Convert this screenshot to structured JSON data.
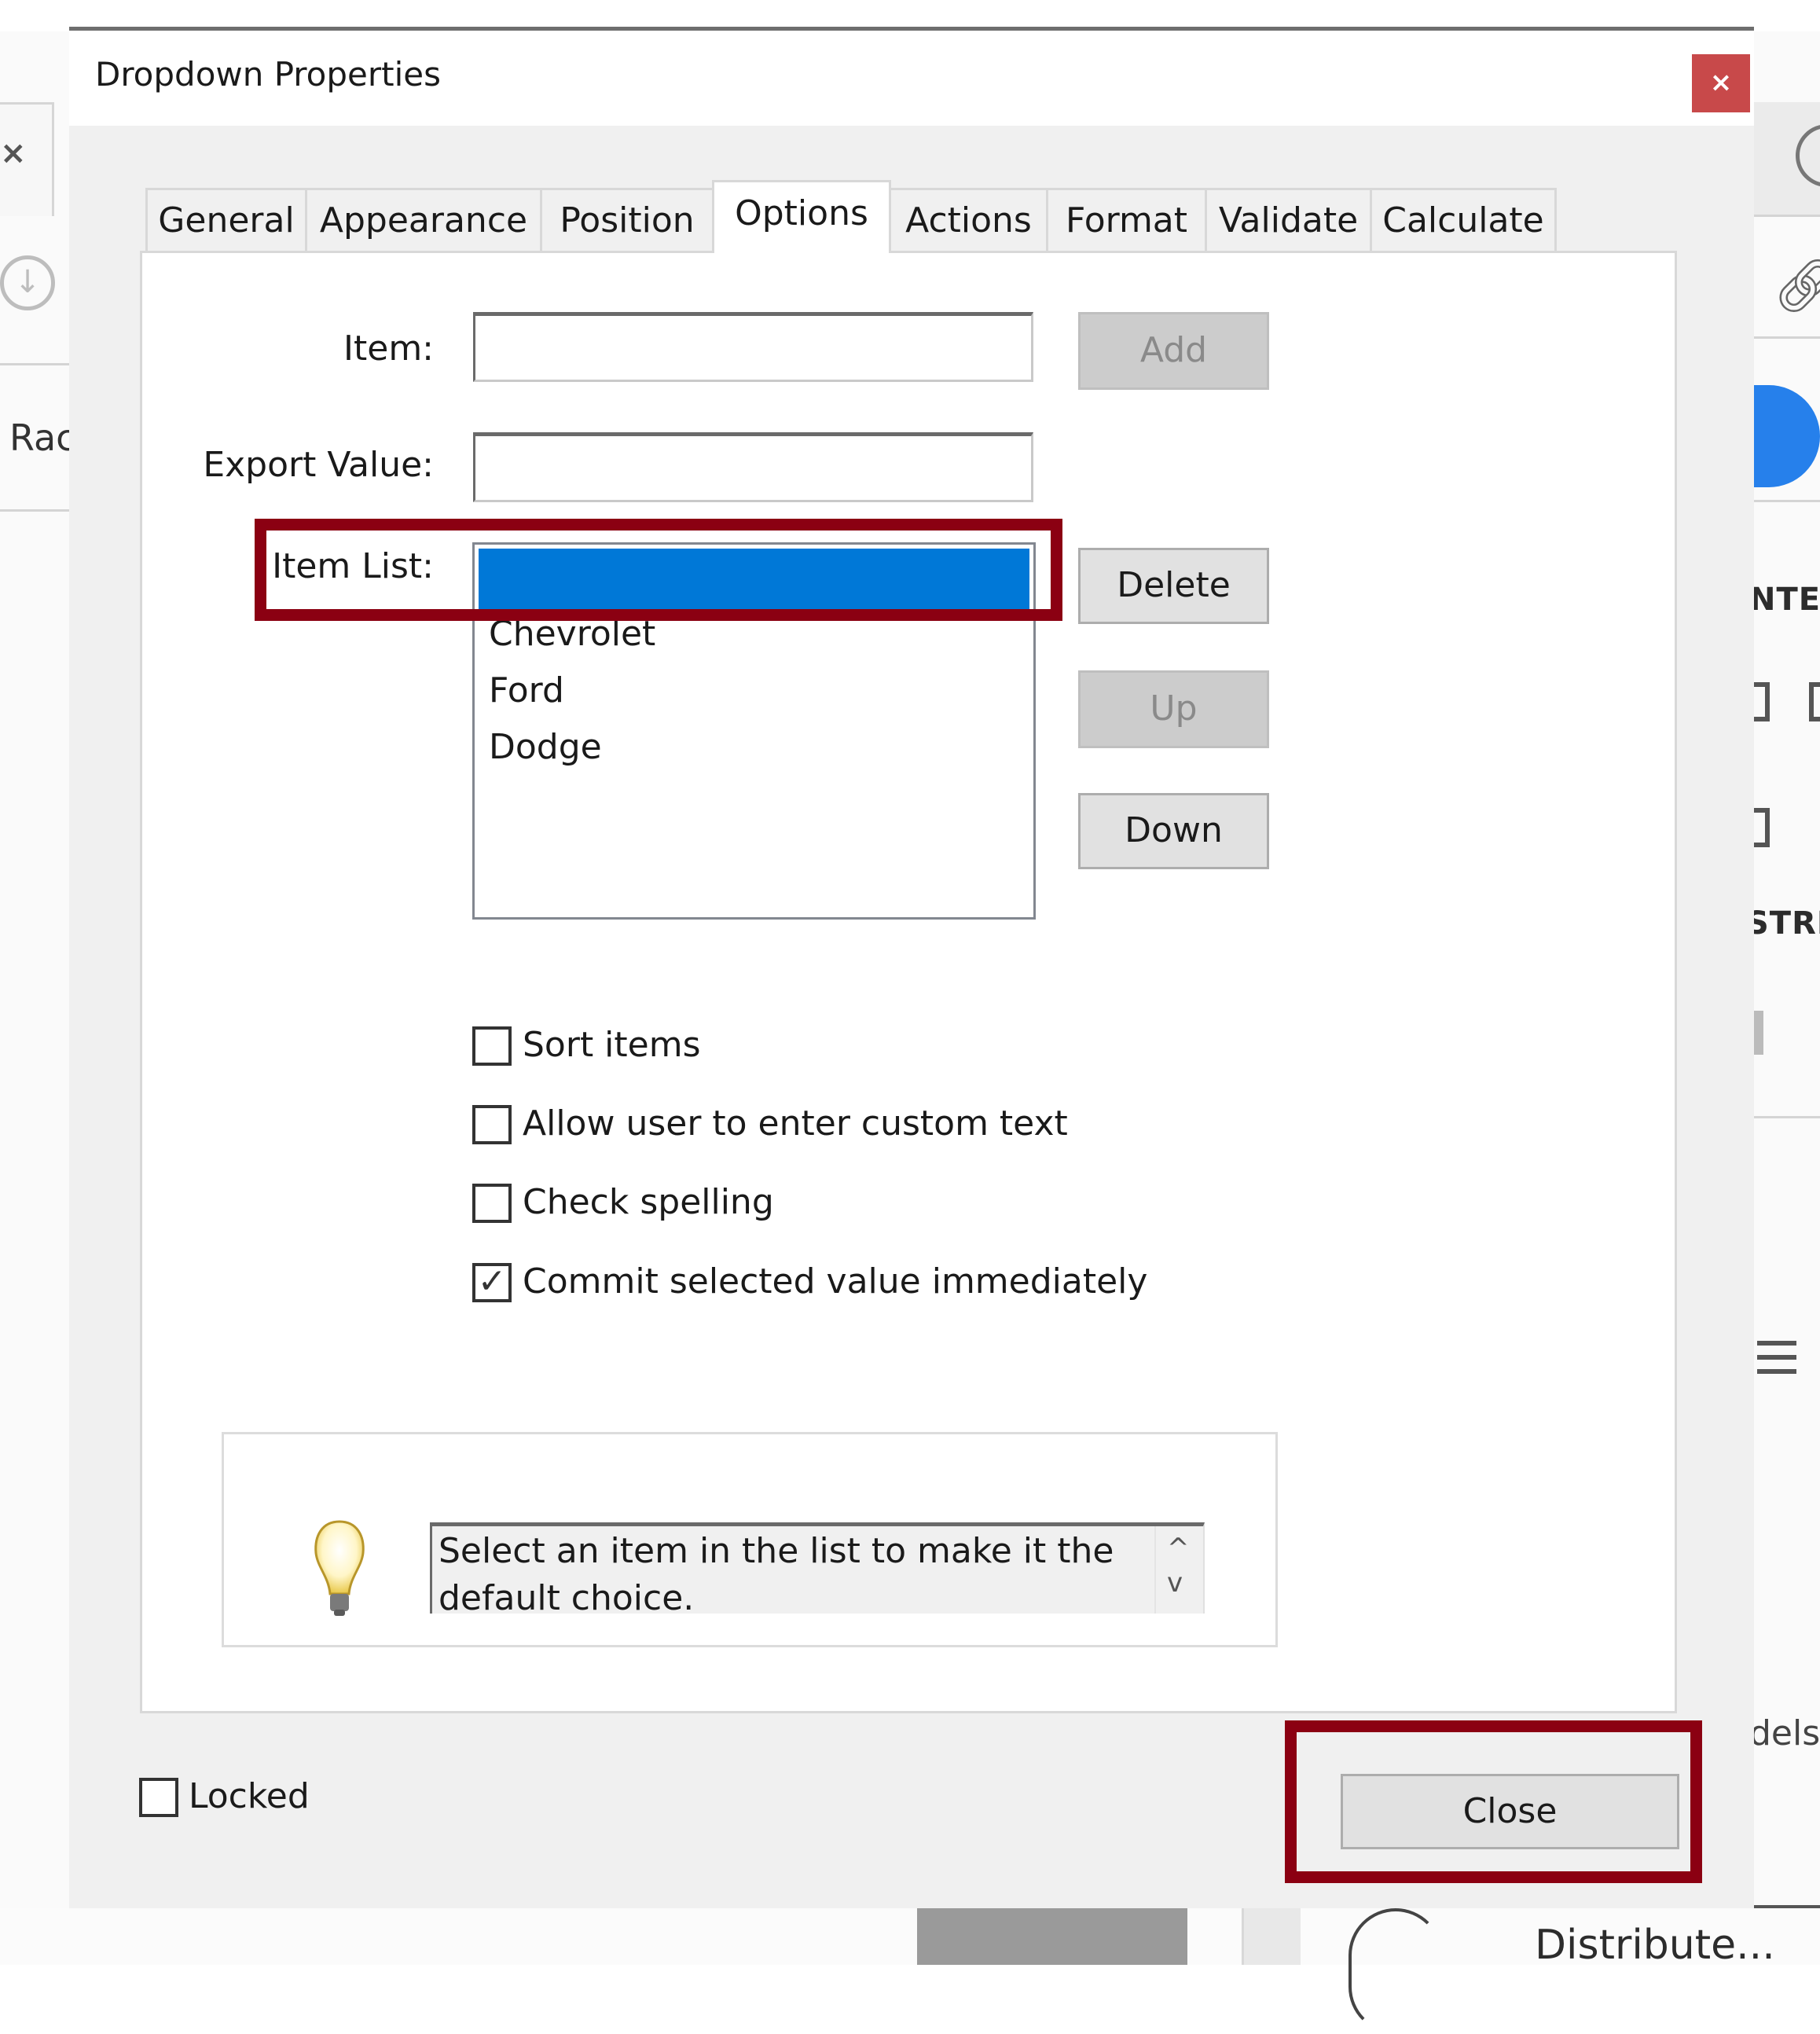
{
  "background_app": {
    "left_tab_close": "×",
    "left_download_icon": "↓",
    "left_partial_text": "Rac",
    "right_partial_text_1": "NTE",
    "right_partial_text_2": "STRI",
    "right_partial_text_models": "dels",
    "bottom_partial_text": "Distribute..."
  },
  "dialog": {
    "title": "Dropdown Properties",
    "close_glyph": "×",
    "tabs": [
      {
        "label": "General",
        "selected": false
      },
      {
        "label": "Appearance",
        "selected": false
      },
      {
        "label": "Position",
        "selected": false
      },
      {
        "label": "Options",
        "selected": true
      },
      {
        "label": "Actions",
        "selected": false
      },
      {
        "label": "Format",
        "selected": false
      },
      {
        "label": "Validate",
        "selected": false
      },
      {
        "label": "Calculate",
        "selected": false
      }
    ],
    "options": {
      "item_label": "Item:",
      "item_value": "",
      "add_label": "Add",
      "export_value_label": "Export Value:",
      "export_value": "",
      "item_list_label": "Item List:",
      "item_list": [
        {
          "label": "",
          "selected": true
        },
        {
          "label": "Chevrolet",
          "selected": false
        },
        {
          "label": "Ford",
          "selected": false
        },
        {
          "label": "Dodge",
          "selected": false
        }
      ],
      "delete_label": "Delete",
      "up_label": "Up",
      "down_label": "Down",
      "checkboxes": [
        {
          "label": "Sort items",
          "checked": false
        },
        {
          "label": "Allow user to enter custom text",
          "checked": false
        },
        {
          "label": "Check spelling",
          "checked": false
        },
        {
          "label": "Commit selected value immediately",
          "checked": true
        }
      ],
      "tip_text": "Select an item in the list to make it the default choice.",
      "tip_scroll_up": "^",
      "tip_scroll_down": "v"
    },
    "locked_label": "Locked",
    "locked_checked": false,
    "close_button_label": "Close",
    "check_glyph": "✓"
  },
  "highlight_color": "#8b0012",
  "selection_color": "#0078d7"
}
